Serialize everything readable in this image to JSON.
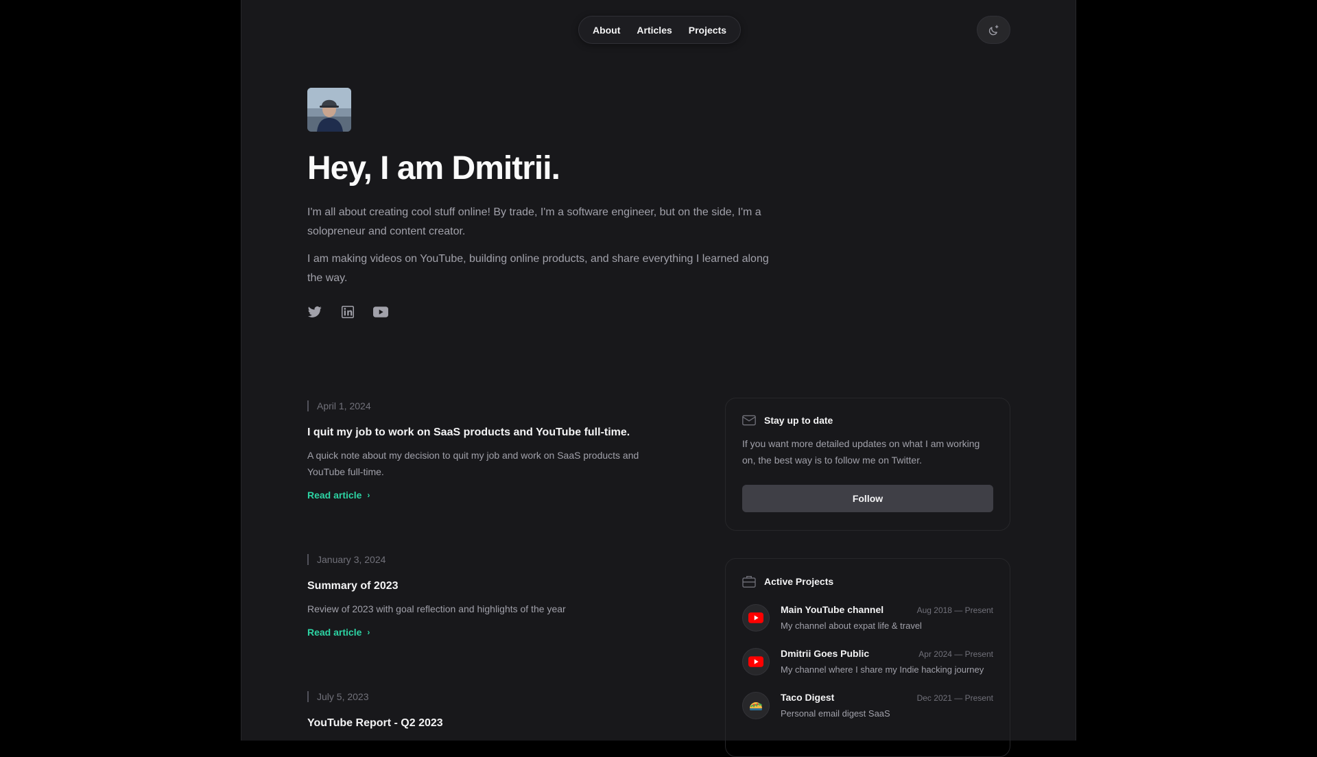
{
  "nav": {
    "items": [
      {
        "label": "About"
      },
      {
        "label": "Articles"
      },
      {
        "label": "Projects"
      }
    ]
  },
  "hero": {
    "title": "Hey, I am Dmitrii.",
    "paragraph1": "I'm all about creating cool stuff online! By trade, I'm a software engineer, but on the side, I'm a solopreneur and content creator.",
    "paragraph2": "I am making videos on YouTube, building online products, and share everything I learned along the way."
  },
  "socials": [
    "twitter-icon",
    "linkedin-icon",
    "youtube-icon"
  ],
  "articles": [
    {
      "date": "April 1, 2024",
      "title": "I quit my job to work on SaaS products and YouTube full-time.",
      "description": "A quick note about my decision to quit my job and work on SaaS products and YouTube full-time.",
      "link": "Read article"
    },
    {
      "date": "January 3, 2024",
      "title": "Summary of 2023",
      "description": "Review of 2023 with goal reflection and highlights of the year",
      "link": "Read article"
    },
    {
      "date": "July 5, 2023",
      "title": "YouTube Report - Q2 2023"
    }
  ],
  "newsletter": {
    "title": "Stay up to date",
    "text": "If you want more detailed updates on what I am working on, the best way is to follow me on Twitter.",
    "button": "Follow"
  },
  "projects": {
    "title": "Active Projects",
    "items": [
      {
        "name": "Main YouTube channel",
        "dates": "Aug 2018 — Present",
        "description": "My channel about expat life & travel",
        "icon": "youtube-logo"
      },
      {
        "name": "Dmitrii Goes Public",
        "dates": "Apr 2024 — Present",
        "description": "My channel where I share my Indie hacking journey",
        "icon": "youtube-logo"
      },
      {
        "name": "Taco Digest",
        "dates": "Dec 2021 — Present",
        "description": "Personal email digest SaaS",
        "icon": "taco-logo"
      }
    ]
  },
  "colors": {
    "background": "#18181b",
    "accent": "#2dd4a4",
    "youtube": "#ff0000"
  }
}
